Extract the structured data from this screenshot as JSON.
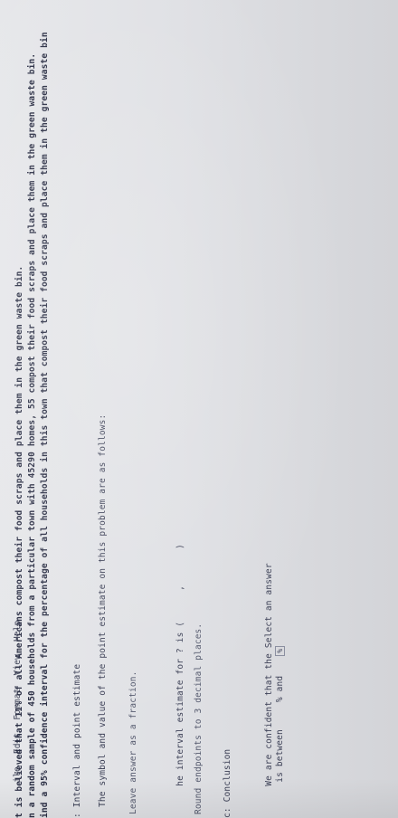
{
  "menu": {
    "items": [
      "ile",
      "Edit",
      "Format",
      "View",
      "Help"
    ]
  },
  "problem": {
    "line1": "t is believed that 11% of all Americans compost their food scraps and place them in the green waste bin.",
    "line2": "n a random sample of 450 households from a particular town with 45290 homes, 55 compost their food scraps and place them in the green waste bin.",
    "line3": "ind a 95% confidence interval for the percentage of all households in this town that compost their food scraps and place them in the green waste bin"
  },
  "part_a": {
    "heading": ": Interval and point estimate",
    "symbol_value": "The symbol and value of the point estimate on this problem are as follows:",
    "leave_fraction": "Leave answer as a fraction.",
    "interval_prefix": "he interval estimate for ? is (",
    "interval_comma": ",",
    "interval_suffix": ")",
    "round_note": "Round endpoints to 3 decimal places."
  },
  "part_c": {
    "heading": "c: Conclusion",
    "confident_prefix": "We are confident that the",
    "select_label": "Select an answer",
    "between_prefix": "is between",
    "pct_and": "% and",
    "pct_end": "%"
  }
}
